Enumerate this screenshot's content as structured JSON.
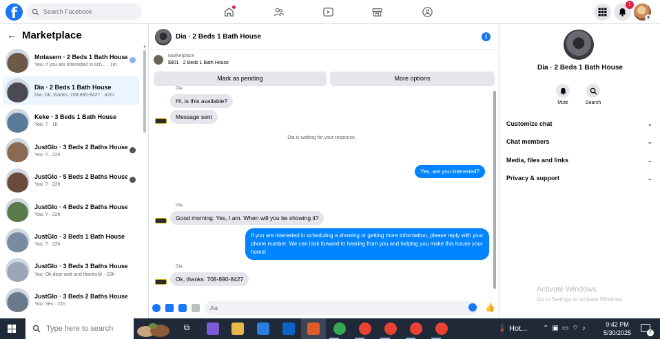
{
  "topbar": {
    "search_placeholder": "Search Facebook",
    "notification_count": "1",
    "nav_icons": [
      "home-icon",
      "friends-icon",
      "video-icon",
      "marketplace-icon",
      "groups-icon"
    ],
    "right_icons": [
      "menu-grid-icon",
      "bell-icon"
    ]
  },
  "sidebar": {
    "title": "Marketplace",
    "threads": [
      {
        "title": "Motasem · 2 Beds 1 Bath House",
        "sub": "You: If you are interested in sch... · 1m",
        "color": "#6b5a48"
      },
      {
        "title": "Dia · 2 Beds 1 Bath House",
        "sub": "Dia: Ok, thanks. 708-890-8427 · 42m",
        "color": "#4a4a52"
      },
      {
        "title": "Keke · 3 Beds 1 Bath House",
        "sub": "You: ? · 1h",
        "color": "#5a7a9a"
      },
      {
        "title": "JustGlo · 3 Beds 2 Baths House",
        "sub": "You: ? · 22h",
        "color": "#8a6a52"
      },
      {
        "title": "JustGlo · 5 Beds 2 Baths House",
        "sub": "You: ? · 22h",
        "color": "#6a4a3a"
      },
      {
        "title": "JustGlo · 4 Beds 2 Baths House",
        "sub": "You: ? · 22h",
        "color": "#5a7a4a"
      },
      {
        "title": "JustGlo · 3 Beds 1 Bath House",
        "sub": "You: ? · 22h",
        "color": "#7a8aa0"
      },
      {
        "title": "JustGlo · 3 Beds 3 Baths House",
        "sub": "You: Ok dear wait and thanks😛 · 22h",
        "color": "#9aa6b8"
      },
      {
        "title": "JustGlo · 3 Beds 2 Baths House",
        "sub": "You: Yes · 22h",
        "color": "#6a7a8a"
      }
    ]
  },
  "chat": {
    "title": "Dia · 2 Beds 1 Bath House",
    "listing_source": "Marketplace",
    "listing_price": "$901 · 2 Beds 1 Bath House",
    "mark_pending": "Mark as pending",
    "more_options": "More options",
    "sender_top": "Dia",
    "msg_available": "Hi, is this available?",
    "msg_sent": "Message sent",
    "waiting_note": "Dia is waiting for your response.",
    "msg_interested": "Yes, are you interested?",
    "sender_mid": "Dia",
    "msg_morning": "Good morning. Yes, I am. When will you be showing it?",
    "msg_schedule": "If you are interested in scheduling a showing or getting more information, please reply with your phone number. We can look forward to hearing from you and helping you make this house your home!",
    "sender_bottom": "Dia",
    "msg_thanks": "Ok, thanks. 708-890-8427",
    "composer_placeholder": "Aa"
  },
  "rpanel": {
    "name": "Dia · 2 Beds 1 Bath House",
    "mute_label": "Mute",
    "search_label": "Search",
    "rows": [
      "Customize chat",
      "Chat members",
      "Media, files and links",
      "Privacy & support"
    ],
    "watermark_title": "Activate Windows",
    "watermark_sub": "Go to Settings to activate Windows."
  },
  "taskbar": {
    "search_placeholder": "Type here to search",
    "weather": "Hot...",
    "time": "9:42 PM",
    "date": "5/30/2025",
    "notif_count": "2"
  }
}
